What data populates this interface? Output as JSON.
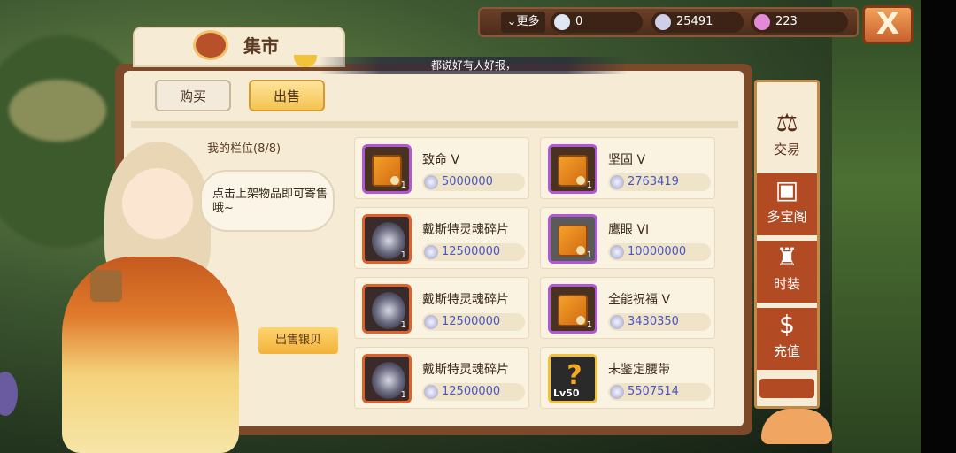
{
  "topbar": {
    "more_label": "更多",
    "star_value": "0",
    "shell_value": "25491",
    "crystal_value": "223",
    "close_label": "X"
  },
  "header": {
    "title": "集市",
    "ticker": "都说好有人好报，"
  },
  "tabs": [
    {
      "label": "购买",
      "active": false
    },
    {
      "label": "出售",
      "active": true
    }
  ],
  "my_slots": {
    "label": "我的栏位(8/8)",
    "hint": "点击上架物品即可寄售哦~",
    "sell_button": "出售银贝"
  },
  "items": [
    {
      "name": "致命 V",
      "price": "5000000",
      "qty": "1",
      "icon": "skill-book-icon"
    },
    {
      "name": "坚固 V",
      "price": "2763419",
      "qty": "1",
      "icon": "skill-book-icon"
    },
    {
      "name": "戴斯特灵魂碎片",
      "price": "12500000",
      "qty": "1",
      "icon": "soul-fragment-icon"
    },
    {
      "name": "鹰眼 VI",
      "price": "10000000",
      "qty": "1",
      "icon": "skill-book-icon"
    },
    {
      "name": "戴斯特灵魂碎片",
      "price": "12500000",
      "qty": "1",
      "icon": "soul-fragment-icon"
    },
    {
      "name": "全能祝福 V",
      "price": "3430350",
      "qty": "1",
      "icon": "skill-book-icon"
    },
    {
      "name": "戴斯特灵魂碎片",
      "price": "12500000",
      "qty": "1",
      "icon": "soul-fragment-icon"
    },
    {
      "name": "未鉴定腰带",
      "price": "5507514",
      "qty": "",
      "level": "Lv50",
      "icon": "unidentified-belt-icon"
    }
  ],
  "nav": [
    {
      "label": "交易",
      "icon": "scale-icon",
      "active": true
    },
    {
      "label": "多宝阁",
      "icon": "treasure-box-icon",
      "active": false
    },
    {
      "label": "时装",
      "icon": "costume-icon",
      "active": false
    },
    {
      "label": "充值",
      "icon": "dollar-icon",
      "active": false
    }
  ],
  "colors": {
    "panel_bg": "#f6ecd6",
    "frame": "#7b4a2a",
    "price_text": "#4a56c4",
    "nav_inactive": "#b24a24",
    "rare_border": "#b157d6",
    "epic_border": "#e06028",
    "gold_border": "#f2c13a"
  }
}
